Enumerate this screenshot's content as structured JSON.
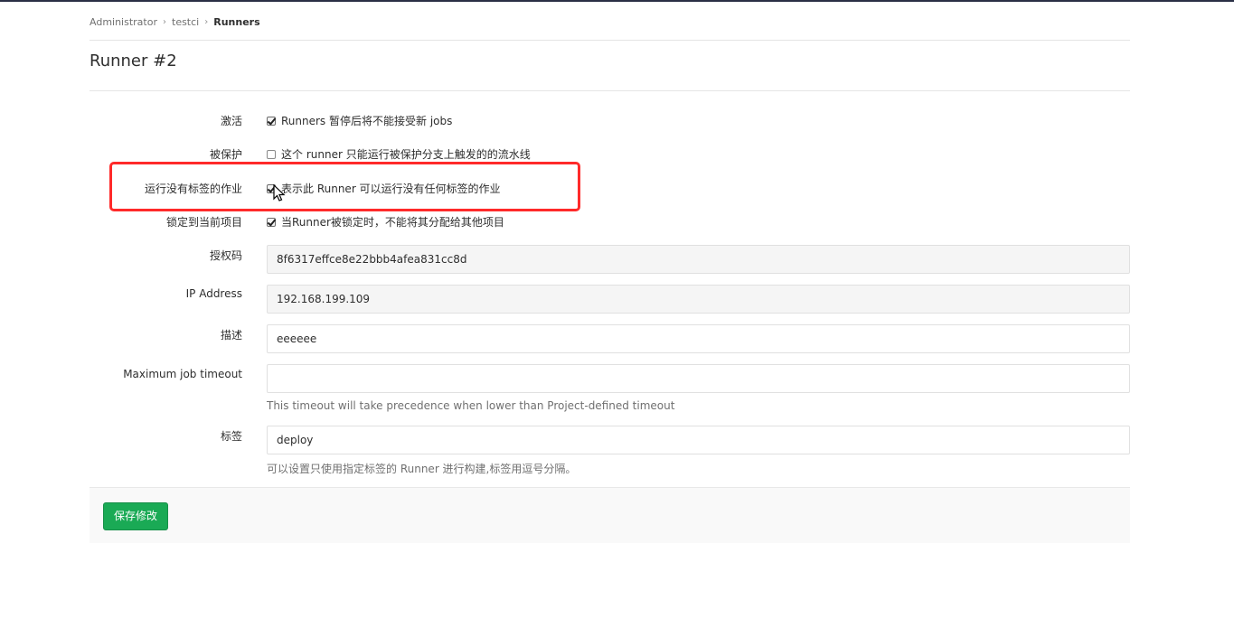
{
  "breadcrumb": {
    "items": [
      "Administrator",
      "testci"
    ],
    "current": "Runners"
  },
  "page": {
    "title": "Runner #2"
  },
  "form": {
    "active": {
      "label": "激活",
      "checked": true,
      "text": "Runners 暂停后将不能接受新 jobs"
    },
    "protected": {
      "label": "被保护",
      "checked": false,
      "text": "这个 runner 只能运行被保护分支上触发的的流水线"
    },
    "run_untagged": {
      "label": "运行没有标签的作业",
      "checked": true,
      "text": "表示此 Runner 可以运行没有任何标签的作业"
    },
    "locked": {
      "label": "锁定到当前项目",
      "checked": true,
      "text": "当Runner被锁定时，不能将其分配给其他项目"
    },
    "token": {
      "label": "授权码",
      "value": "8f6317effce8e22bbb4afea831cc8d"
    },
    "ip_address": {
      "label": "IP Address",
      "value": "192.168.199.109"
    },
    "description": {
      "label": "描述",
      "value": "eeeeee"
    },
    "max_timeout": {
      "label": "Maximum job timeout",
      "value": "",
      "help": "This timeout will take precedence when lower than Project-defined timeout"
    },
    "tags": {
      "label": "标签",
      "value": "deploy",
      "help": "可以设置只使用指定标签的 Runner 进行构建,标签用逗号分隔。"
    }
  },
  "actions": {
    "save_label": "保存修改"
  },
  "colors": {
    "primary_button": "#1aaa55",
    "highlight_box": "#ff2a2a"
  }
}
